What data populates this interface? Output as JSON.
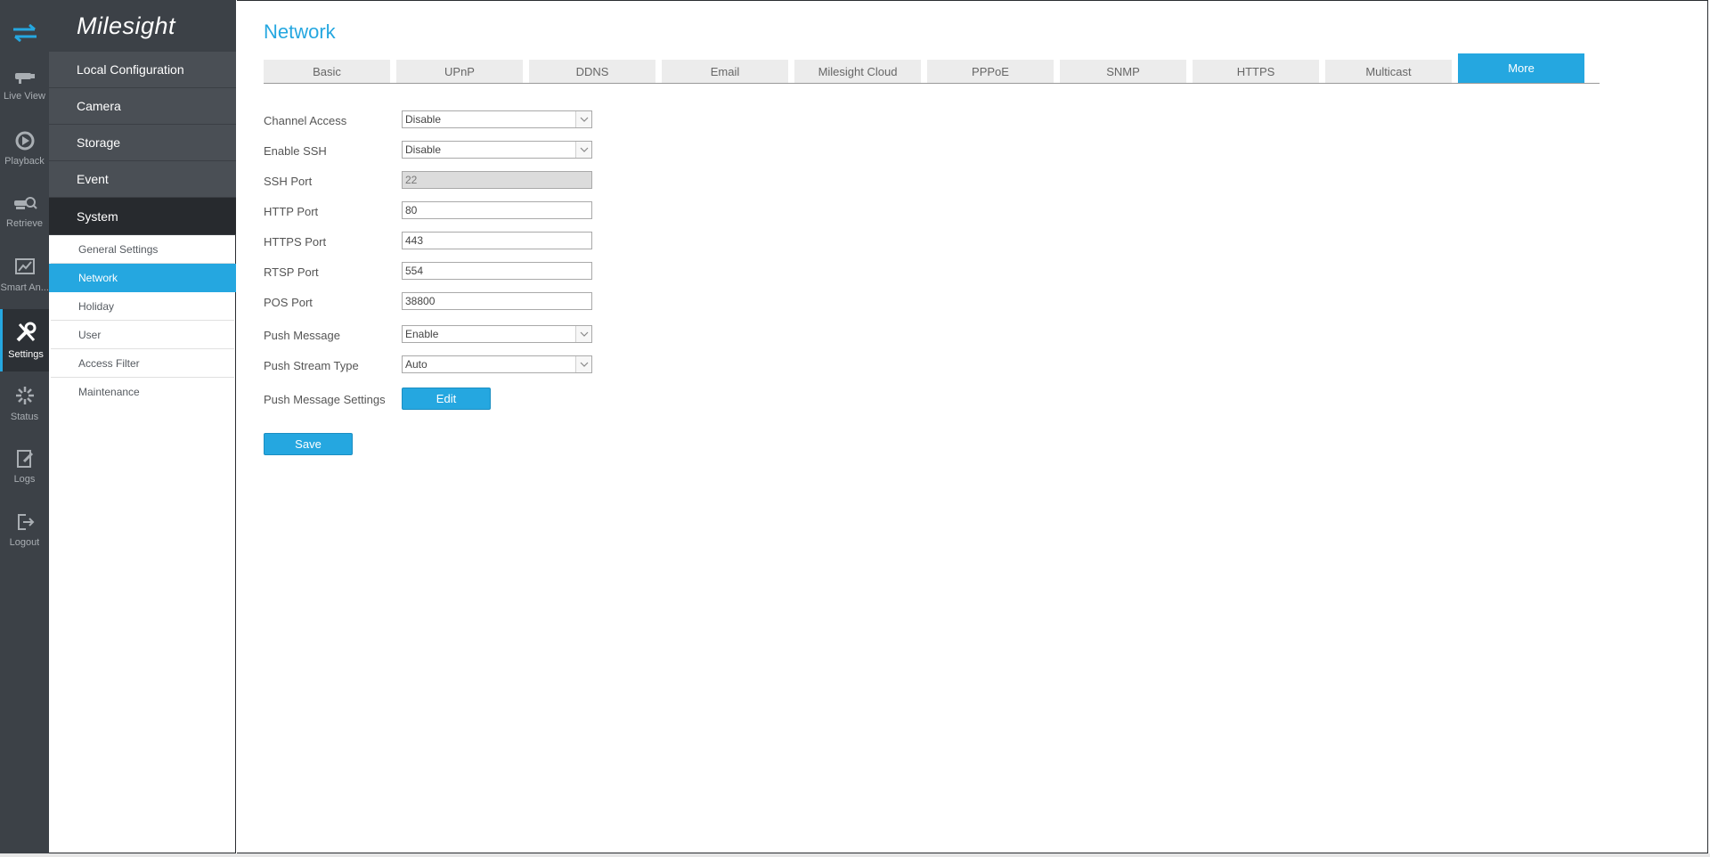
{
  "rail": {
    "items": [
      {
        "label": "Live View",
        "icon": "live-view-icon"
      },
      {
        "label": "Playback",
        "icon": "playback-icon"
      },
      {
        "label": "Retrieve",
        "icon": "retrieve-icon"
      },
      {
        "label": "Smart An...",
        "icon": "smart-analytics-icon"
      },
      {
        "label": "Settings",
        "icon": "settings-icon"
      },
      {
        "label": "Status",
        "icon": "status-icon"
      },
      {
        "label": "Logs",
        "icon": "logs-icon"
      },
      {
        "label": "Logout",
        "icon": "logout-icon"
      }
    ]
  },
  "menu": {
    "logo": "Milesight",
    "categories": [
      "Local Configuration",
      "Camera",
      "Storage",
      "Event",
      "System"
    ],
    "sub_items": [
      "General Settings",
      "Network",
      "Holiday",
      "User",
      "Access Filter",
      "Maintenance"
    ]
  },
  "page": {
    "title": "Network",
    "tabs": [
      "Basic",
      "UPnP",
      "DDNS",
      "Email",
      "Milesight Cloud",
      "PPPoE",
      "SNMP",
      "HTTPS",
      "Multicast",
      "More"
    ]
  },
  "form": {
    "channel_access": {
      "label": "Channel Access",
      "value": "Disable"
    },
    "enable_ssh": {
      "label": "Enable SSH",
      "value": "Disable"
    },
    "ssh_port": {
      "label": "SSH Port",
      "value": "22"
    },
    "http_port": {
      "label": "HTTP Port",
      "value": "80"
    },
    "https_port": {
      "label": "HTTPS Port",
      "value": "443"
    },
    "rtsp_port": {
      "label": "RTSP Port",
      "value": "554"
    },
    "pos_port": {
      "label": "POS Port",
      "value": "38800"
    },
    "push_message": {
      "label": "Push Message",
      "value": "Enable"
    },
    "push_stream_type": {
      "label": "Push Stream Type",
      "value": "Auto"
    },
    "push_message_settings": {
      "label": "Push Message Settings",
      "button": "Edit"
    },
    "save": "Save"
  },
  "colors": {
    "accent": "#25a7e0",
    "rail_bg": "#3c4147",
    "menu_bg": "#4a4f55",
    "menu_active": "#272a2e"
  }
}
